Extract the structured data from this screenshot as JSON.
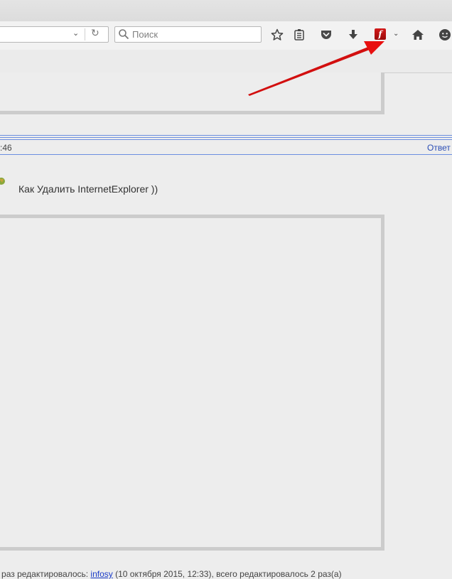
{
  "browser": {
    "search_placeholder": "Поиск",
    "url_dropdown_glyph": "⌄",
    "reload_glyph": "↻",
    "flash_letter": "f",
    "flash_dropdown_glyph": "⌄"
  },
  "post": {
    "time_fragment": ":46",
    "reply_label": "Ответ",
    "text": "Как Удалить InternetExplorer ))"
  },
  "edit_note": {
    "prefix": "й раз редактировалось: ",
    "author": "infosy",
    "suffix": " (10 октября 2015, 12:33), всего редактировалось 2 раз(а)"
  },
  "colors": {
    "annotation_arrow": "#e81010",
    "separator": "#6b8ee0",
    "flash_icon": "#c21414"
  }
}
